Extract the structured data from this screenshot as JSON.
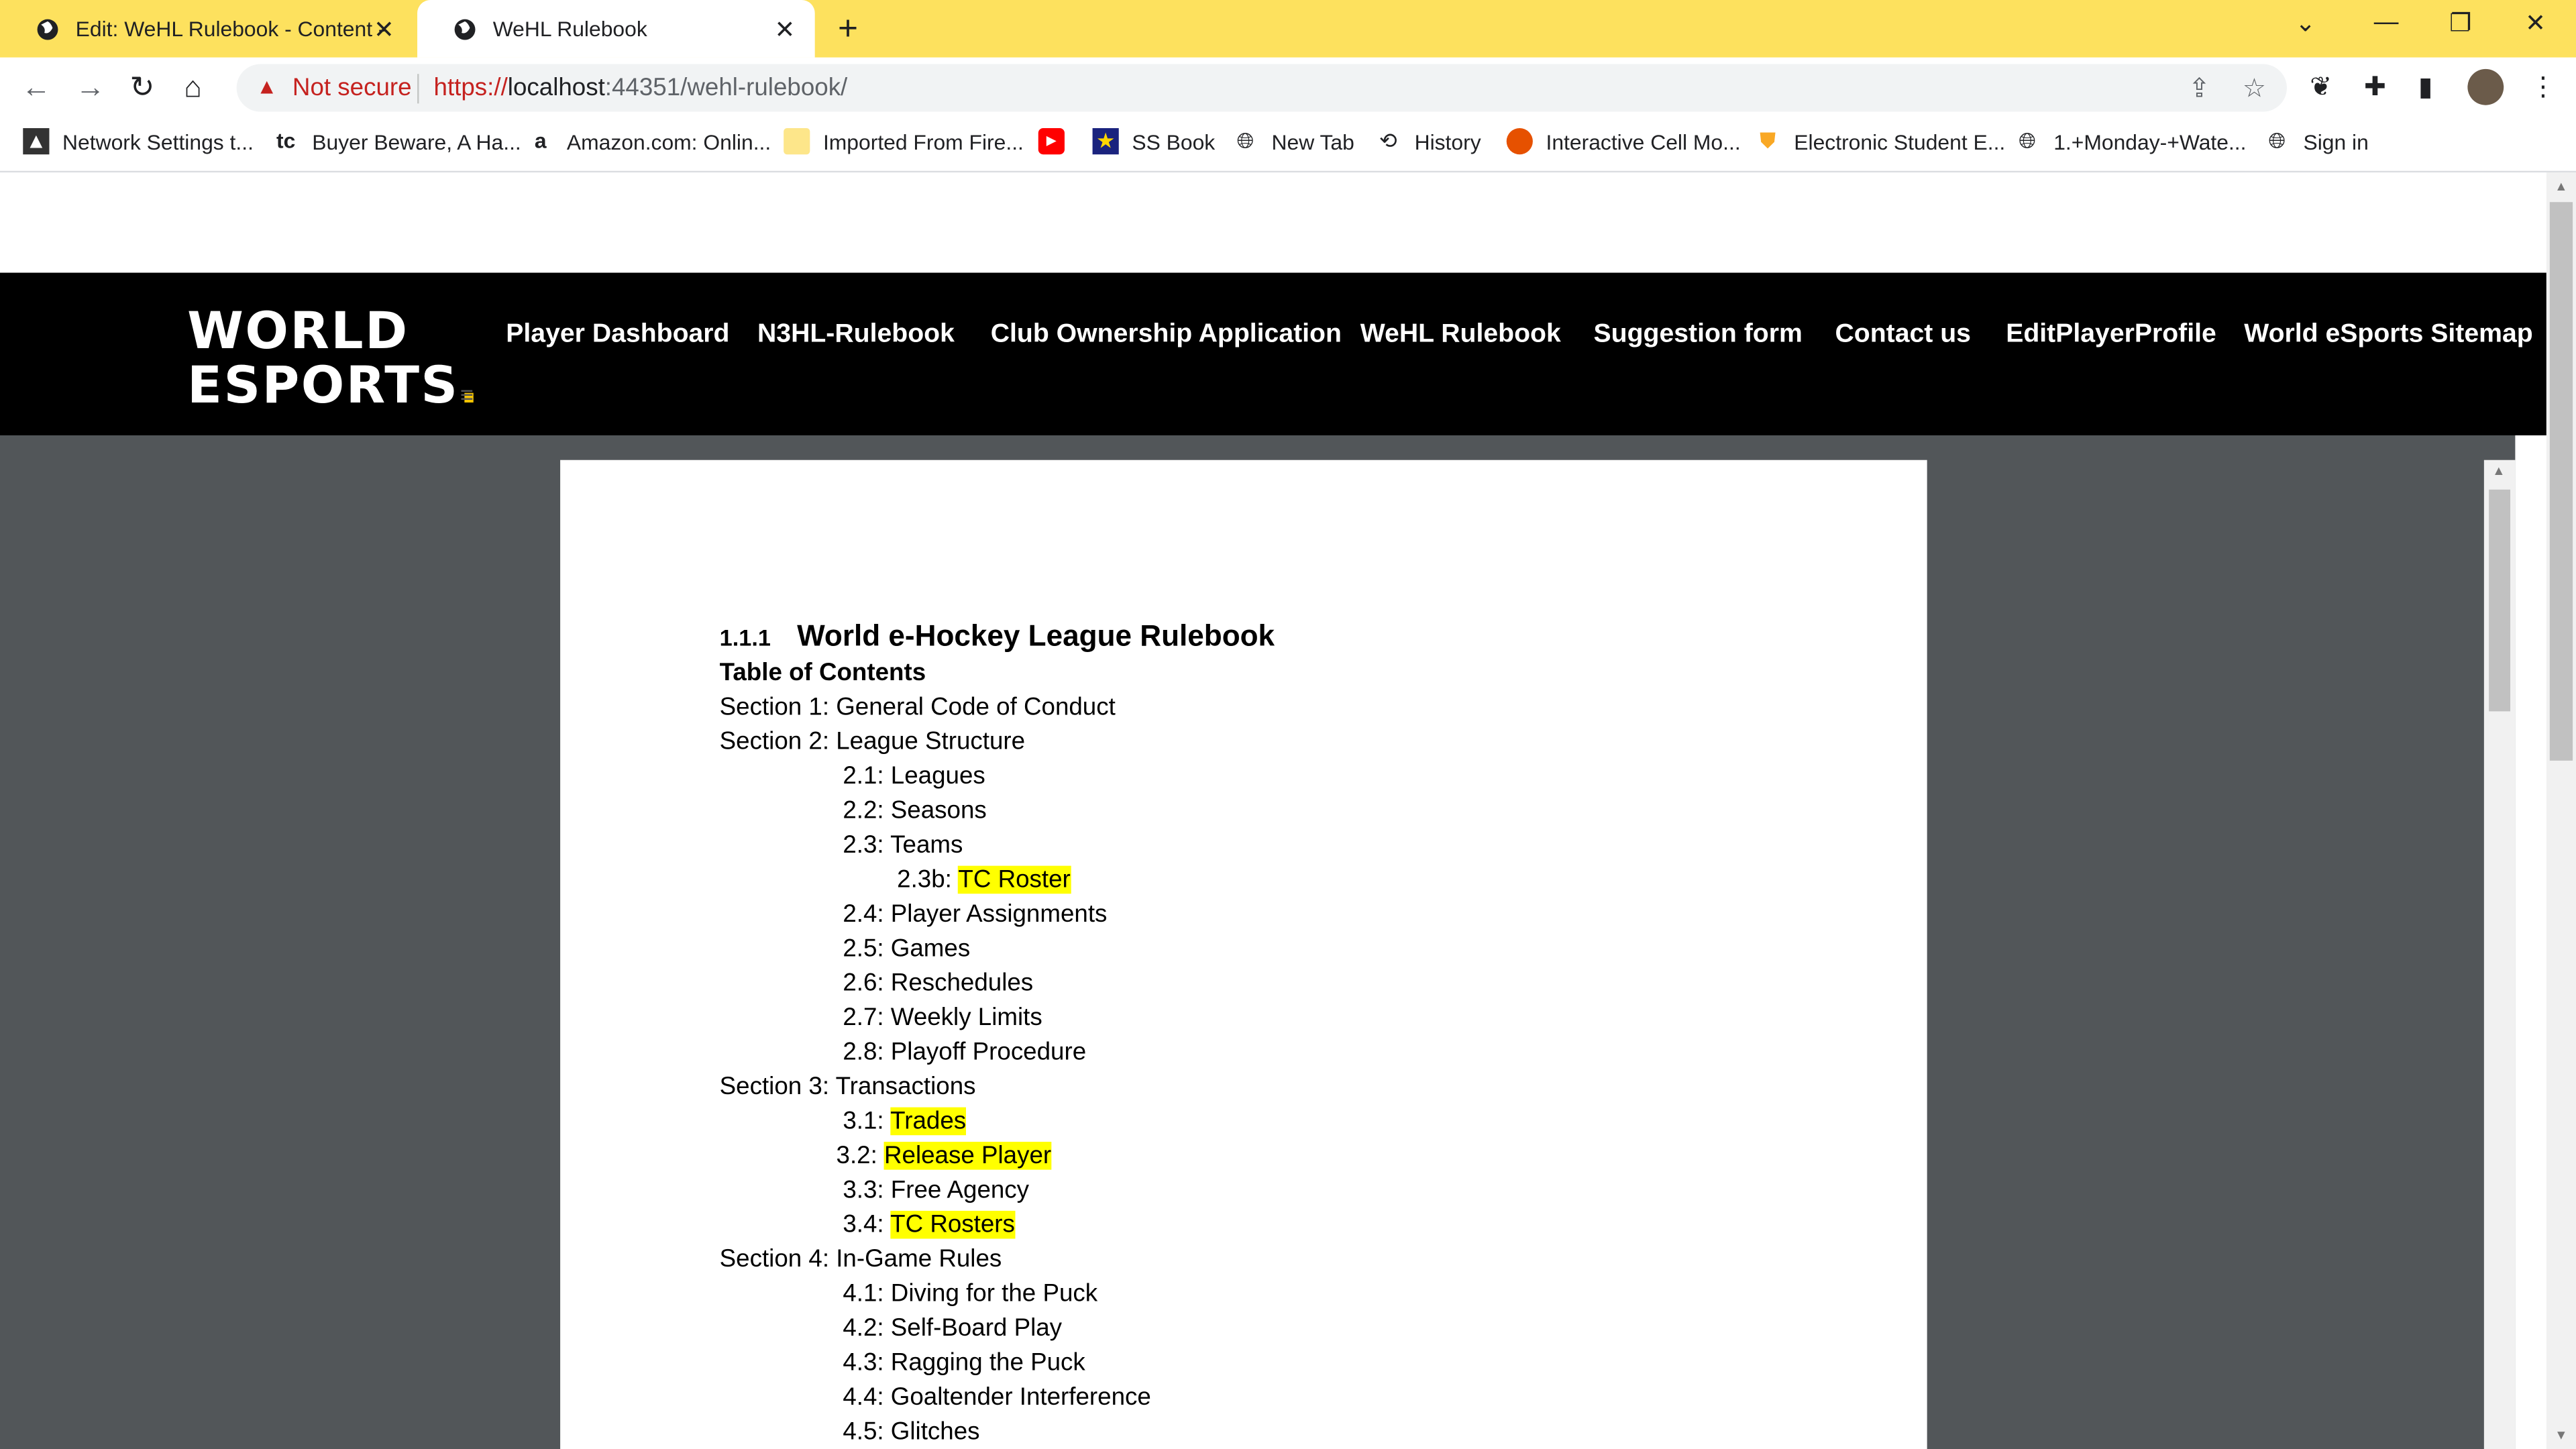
{
  "browser": {
    "tabs": [
      {
        "title": "Edit: WeHL Rulebook - Content -",
        "active": false
      },
      {
        "title": "WeHL Rulebook",
        "active": true
      }
    ],
    "new_tab": "+",
    "address": {
      "security_label": "Not secure",
      "url_scheme": "https://",
      "url_host": "localhost",
      "url_rest": ":44351/wehl-rulebook/"
    },
    "bookmarks": [
      {
        "label": "Network Settings t...",
        "icon": "network-icon"
      },
      {
        "label": "Buyer Beware, A Ha...",
        "icon": "tc-icon"
      },
      {
        "label": "Amazon.com: Onlin...",
        "icon": "amazon-icon"
      },
      {
        "label": "Imported From Fire...",
        "icon": "folder-icon"
      },
      {
        "label": "",
        "icon": "youtube-icon"
      },
      {
        "label": "SS Book",
        "icon": "star-icon"
      },
      {
        "label": "New Tab",
        "icon": "globe-icon"
      },
      {
        "label": "History",
        "icon": "history-icon"
      },
      {
        "label": "Interactive Cell Mo...",
        "icon": "cell-icon"
      },
      {
        "label": "Electronic Student E...",
        "icon": "shield-icon"
      },
      {
        "label": "1.+Monday-+Wate...",
        "icon": "globe-icon"
      },
      {
        "label": "Sign in",
        "icon": "globe-icon"
      }
    ]
  },
  "site": {
    "logo_line1": "WORLD",
    "logo_line2": "ESPORTS",
    "logo_dot": ".",
    "nav": [
      "Player Dashboard",
      "N3HL-Rulebook",
      "Club Ownership Application",
      "WeHL Rulebook",
      "Suggestion form",
      "Contact us",
      "EditPlayerProfile",
      "World eSports Sitemap"
    ]
  },
  "document": {
    "heading_number": "1.1.1",
    "heading": "World e-Hockey League Rulebook",
    "toc_title": "Table of Contents",
    "items": [
      {
        "prefix": "Section 1: General Code of Conduct",
        "hl": ""
      },
      {
        "prefix": "Section 2: League Structure",
        "hl": ""
      },
      {
        "prefix": "2.1: Leagues",
        "hl": ""
      },
      {
        "prefix": "2.2: Seasons",
        "hl": ""
      },
      {
        "prefix": "2.3: Teams",
        "hl": ""
      },
      {
        "prefix": "2.3b: ",
        "hl": "TC Roster"
      },
      {
        "prefix": "2.4: Player Assignments",
        "hl": ""
      },
      {
        "prefix": "2.5: Games",
        "hl": ""
      },
      {
        "prefix": "2.6: Reschedules",
        "hl": ""
      },
      {
        "prefix": "2.7: Weekly Limits",
        "hl": ""
      },
      {
        "prefix": "2.8: Playoff Procedure",
        "hl": ""
      },
      {
        "prefix": "Section 3: Transactions",
        "hl": ""
      },
      {
        "prefix": "3.1: ",
        "hl": "Trades"
      },
      {
        "prefix": "3.2: ",
        "hl": "Release Player"
      },
      {
        "prefix": "3.3: Free Agency",
        "hl": ""
      },
      {
        "prefix": "3.4: ",
        "hl": "TC Rosters"
      },
      {
        "prefix": "Section 4: In-Game Rules",
        "hl": ""
      },
      {
        "prefix": "4.1: Diving for the Puck",
        "hl": ""
      },
      {
        "prefix": "4.2: Self-Board Play",
        "hl": ""
      },
      {
        "prefix": "4.3: Ragging the Puck",
        "hl": ""
      },
      {
        "prefix": "4.4: Goaltender Interference",
        "hl": ""
      },
      {
        "prefix": "4.5: Glitches",
        "hl": ""
      }
    ]
  },
  "colors": {
    "tabstrip": "#fde15e",
    "header": "#000000",
    "accent": "#f5c400",
    "viewer_bg": "#525659",
    "highlight": "#ffff00"
  }
}
